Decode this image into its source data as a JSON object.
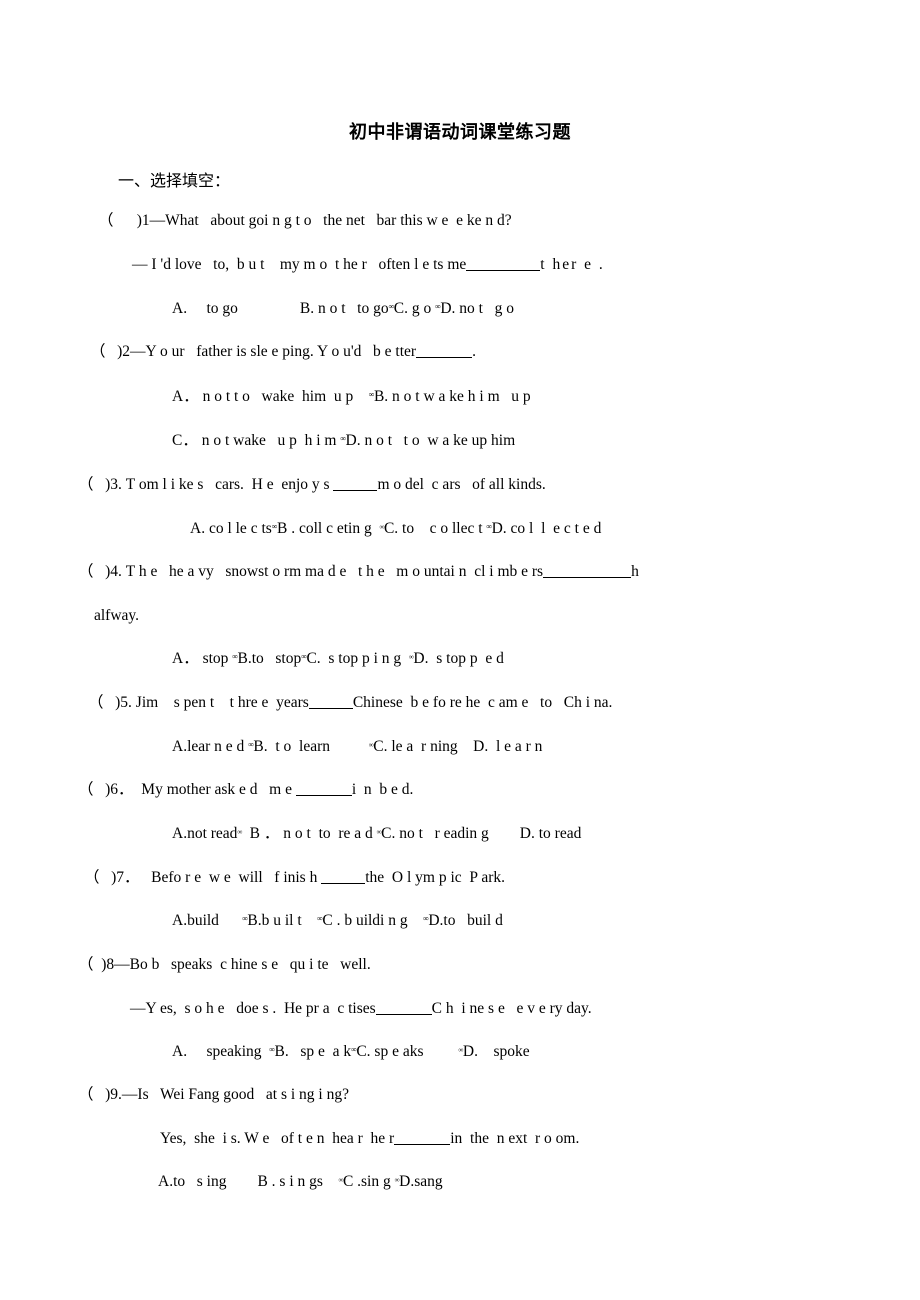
{
  "document": {
    "title": "初中非谓语动词课堂练习题",
    "section_heading": "一、选择填空："
  },
  "separator_glyph": "∞",
  "questions": [
    {
      "number": "1",
      "marker": "（      )1",
      "stem": "—What   about goi n g t o   the net   bar this w e  e ke n d?",
      "reply": "— I 'd love   to,  b u t    my m o  t he r   often l e ts me",
      "reply_tail": "t her e .",
      "options_lines": [
        {
          "parts": [
            "A.     to go                B. n o t   to go",
            "C. g o ",
            "D. no t   g o"
          ]
        }
      ]
    },
    {
      "number": "2",
      "marker": "（   )2",
      "stem": "—Y o ur   father is sle e ping. Y o u'd   b e tter",
      "stem_tail": ".",
      "options_lines": [
        {
          "parts": [
            "A． n o t t o   wake  him  u p    ",
            "B. n o t w a ke h i m   u p"
          ]
        },
        {
          "parts": [
            "C． n o t wake   u p  h i m ",
            "D. n o t   t o  w a ke up him"
          ]
        }
      ]
    },
    {
      "number": "3",
      "marker": "（   )3",
      "stem_a": ". T om l i ke s   cars.  H e  enjo y s ",
      "stem_b": "m o del  c ars   of all kinds.",
      "options_lines": [
        {
          "parts": [
            "A. co l le c ts",
            "B . coll c etin g  ",
            "C. to    c o llec t ",
            "D. co l  l  e c t e d"
          ]
        }
      ]
    },
    {
      "number": "4",
      "marker": "（   )4",
      "stem_a": ". T h e   he a vy   snowst o rm ma d e   t h e   m o untai n  cl i mb e rs",
      "stem_b": "h",
      "continuation": "alfway.",
      "options_lines": [
        {
          "parts": [
            "A． stop ",
            "B.to   stop",
            "C.  s top p i n g  ",
            "D.  s top p  e d"
          ]
        }
      ]
    },
    {
      "number": "5",
      "marker": "（   )5",
      "stem_a": ". Jim    s pen t    t hre e  years",
      "stem_b": "Chinese  b e fo re he  c am e   to   Ch i na.",
      "options_lines": [
        {
          "parts": [
            "A.lear n e d ",
            "B.  t o  learn          ",
            "C. le a  r ning    D.  l e a r n"
          ]
        }
      ]
    },
    {
      "number": "6",
      "marker": "（   )6",
      "stem_a": "．  My mother ask e d   m e ",
      "stem_b": "i  n  b e d.",
      "options_lines": [
        {
          "parts": [
            "A.not read",
            "  B ． n o t  to  re a d ",
            "C. no t   r eadin g        D. to read"
          ]
        }
      ]
    },
    {
      "number": "7",
      "marker": "（   )7",
      "stem_a": "．   Befo r e  w e  will   f inis h ",
      "stem_b": "the  O l ym p ic  P ark.",
      "options_lines": [
        {
          "parts": [
            "A.build      ",
            "B.b u il t    ",
            "C . b uildi n g    ",
            "D.to   buil d"
          ]
        }
      ]
    },
    {
      "number": "8",
      "marker": "（  )8",
      "stem": "—Bo b   speaks  c hine s e   qu i te   well.",
      "reply_a": "—Y es,  s o h e   doe s .  He pr a  c tises",
      "reply_b": "C h  i ne s e   e v e ry day.",
      "options_lines": [
        {
          "parts": [
            "A.     speaking  ",
            "B.   sp e  a k",
            "C. sp e aks         ",
            "D.    spoke"
          ]
        }
      ]
    },
    {
      "number": "9",
      "marker": "（   )9",
      "stem": ".—Is   Wei Fang good   at s i ng i ng?",
      "reply_a": "Yes,  she  i s. W e   of t e n  hea r  he r",
      "reply_b": "in  the  n ext  r o om.",
      "options_lines": [
        {
          "parts": [
            "A.to   s ing        B . s i n gs    ",
            "C .sin g ",
            "D.sang"
          ]
        }
      ]
    }
  ]
}
